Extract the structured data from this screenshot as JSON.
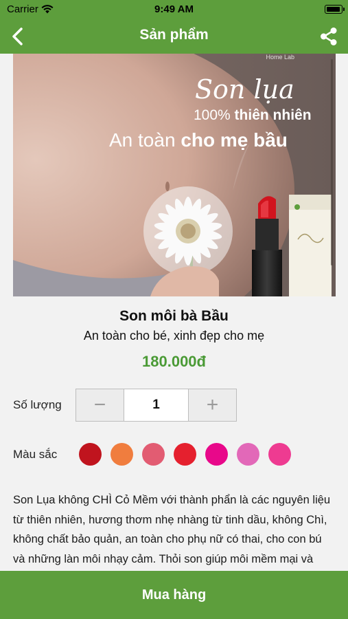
{
  "status_bar": {
    "carrier": "Carrier",
    "time": "9:49 AM"
  },
  "nav": {
    "title": "Sản phẩm"
  },
  "hero": {
    "brand": "Home Lab",
    "script_title": "Son lụa",
    "line1_prefix": "100% ",
    "line1_bold": "thiên nhiên",
    "line2_prefix": "An toàn ",
    "line2_bold": "cho mẹ bầu"
  },
  "product": {
    "name": "Son môi bà Bầu",
    "subtitle": "An toàn cho bé, xinh đẹp cho mẹ",
    "price": "180.000đ"
  },
  "quantity": {
    "label": "Số lượng",
    "minus": "−",
    "value": "1",
    "plus": "+"
  },
  "colors": {
    "label": "Màu sắc",
    "swatches": [
      "#c0141e",
      "#f07d3e",
      "#e25c72",
      "#e5202e",
      "#e8088a",
      "#e268b8",
      "#ee3b91"
    ]
  },
  "description": "Son Lụa không CHÌ Cỏ Mềm với thành phẩn là các nguyên liệu từ thiên nhiên, hương thơm nhẹ nhàng từ tinh dầu, không Chì, không chất bảo quản, an toàn cho phụ nữ có thai, cho con bú và những làn môi nhạy cảm. Thỏi son giúp môi mềm mại và tươi tắn hơn mỗi ngày.",
  "buy_button": {
    "label": "Mua hàng"
  },
  "theme": {
    "primary": "#5d9e3c",
    "price": "#4a9a35"
  }
}
